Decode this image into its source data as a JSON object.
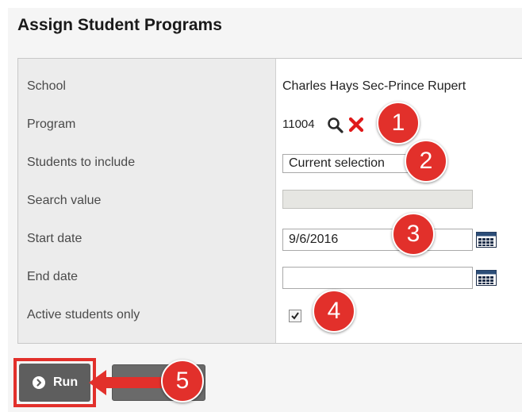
{
  "page": {
    "title": "Assign Student Programs"
  },
  "form": {
    "school": {
      "label": "School",
      "value": "Charles Hays Sec-Prince Rupert"
    },
    "program": {
      "label": "Program",
      "value": "11004"
    },
    "students": {
      "label": "Students to include",
      "value": "Current selection"
    },
    "search": {
      "label": "Search value",
      "value": ""
    },
    "start_date": {
      "label": "Start date",
      "value": "9/6/2016"
    },
    "end_date": {
      "label": "End date",
      "value": ""
    },
    "active_only": {
      "label": "Active students only",
      "checked": true
    }
  },
  "buttons": {
    "run_label": "Run"
  },
  "callouts": [
    "1",
    "2",
    "3",
    "4",
    "5"
  ],
  "icons": {
    "program_search": "magnifier-icon",
    "program_clear": "close-x-icon",
    "calendar": "calendar-icon",
    "run": "chevron-circle-icon"
  },
  "colors": {
    "callout": "#e2302b",
    "run_button": "#5e5e5e"
  }
}
